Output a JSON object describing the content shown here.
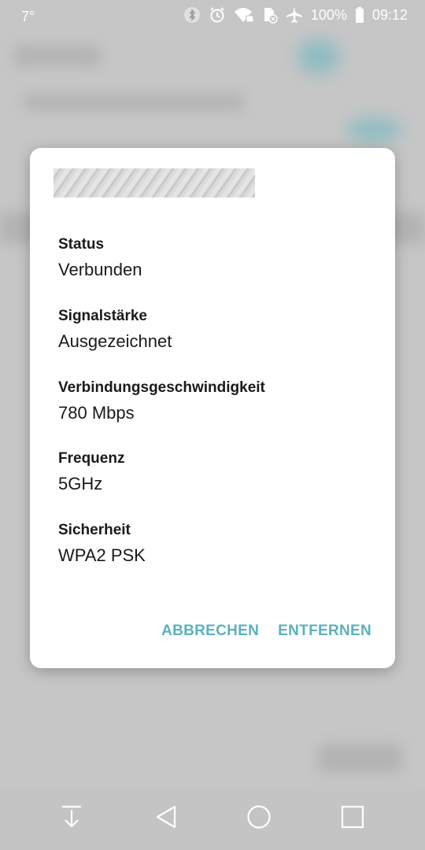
{
  "status_bar": {
    "temperature": "7°",
    "battery": "100%",
    "time": "09:12"
  },
  "dialog": {
    "fields": [
      {
        "label": "Status",
        "value": "Verbunden"
      },
      {
        "label": "Signalstärke",
        "value": "Ausgezeichnet"
      },
      {
        "label": "Verbindungsgeschwindigkeit",
        "value": "780 Mbps"
      },
      {
        "label": "Frequenz",
        "value": "5GHz"
      },
      {
        "label": "Sicherheit",
        "value": "WPA2 PSK"
      }
    ],
    "cancel_label": "ABBRECHEN",
    "remove_label": "ENTFERNEN"
  },
  "colors": {
    "accent": "#5bb1bd",
    "scrim": "#c2c2c2"
  },
  "nav_bar": {
    "icons": [
      "download-icon",
      "back-icon",
      "home-icon",
      "recents-icon"
    ]
  }
}
